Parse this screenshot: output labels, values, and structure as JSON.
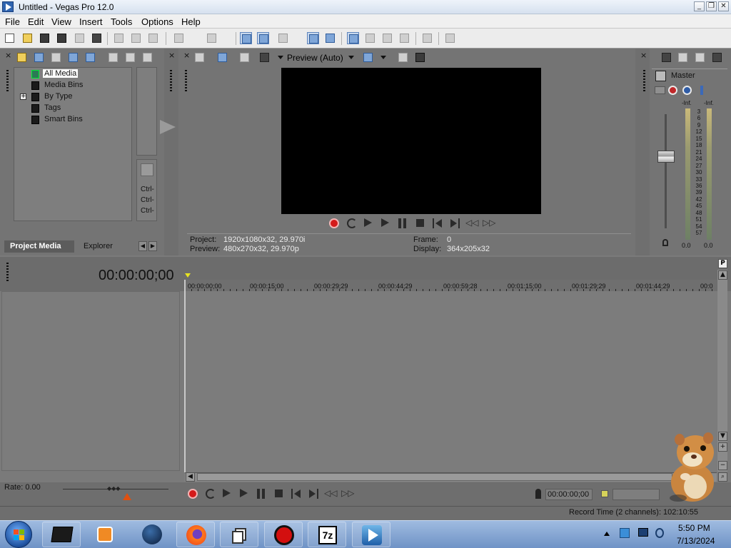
{
  "window": {
    "title": "Untitled - Vegas Pro 12.0",
    "minimize": "_",
    "restore": "❐",
    "close": "✕"
  },
  "menu": [
    "File",
    "Edit",
    "View",
    "Insert",
    "Tools",
    "Options",
    "Help"
  ],
  "project_media": {
    "tree": [
      {
        "label": "All Media",
        "selected": true
      },
      {
        "label": "Media Bins"
      },
      {
        "label": "By Type",
        "expandable": true
      },
      {
        "label": "Tags"
      },
      {
        "label": "Smart Bins"
      }
    ],
    "ctrl_labels": [
      "Ctrl-",
      "Ctrl-",
      "Ctrl-"
    ],
    "tabs": [
      "Project Media",
      "Explorer"
    ]
  },
  "preview": {
    "mode": "Preview (Auto)",
    "project_label": "Project:",
    "project_value": "1920x1080x32, 29.970i",
    "preview_label": "Preview:",
    "preview_value": "480x270x32, 29.970p",
    "frame_label": "Frame:",
    "frame_value": "0",
    "display_label": "Display:",
    "display_value": "364x205x32"
  },
  "mixer": {
    "master_label": "Master",
    "inf_left": "-Inf.",
    "inf_right": "-Inf.",
    "scale": [
      "3",
      "6",
      "9",
      "12",
      "15",
      "18",
      "21",
      "24",
      "27",
      "30",
      "33",
      "36",
      "39",
      "42",
      "45",
      "48",
      "51",
      "54",
      "57"
    ],
    "left_value": "0.0",
    "right_value": "0.0"
  },
  "timeline": {
    "timecode": "00:00:00;00",
    "ruler": [
      "00:00:00;00",
      "00:00:15;00",
      "00:00:29;29",
      "00:00:44;29",
      "00:00:59;28",
      "00:01:15;00",
      "00:01:29;29",
      "00:01:44;29",
      "00:0"
    ],
    "rate_label": "Rate: 0.00",
    "cursor_time": "00:00:00;00",
    "record_time": "Record Time (2 channels): 102:10:55"
  },
  "taskbar": {
    "time": "5:50 PM",
    "date": "7/13/2024",
    "apps": [
      "terminal-app",
      "media-player-app",
      "globe-app",
      "firefox-app",
      "file-manager-app",
      "recorder-app",
      "7zip-app",
      "vegas-app"
    ],
    "sevenzip_label": "7z"
  }
}
